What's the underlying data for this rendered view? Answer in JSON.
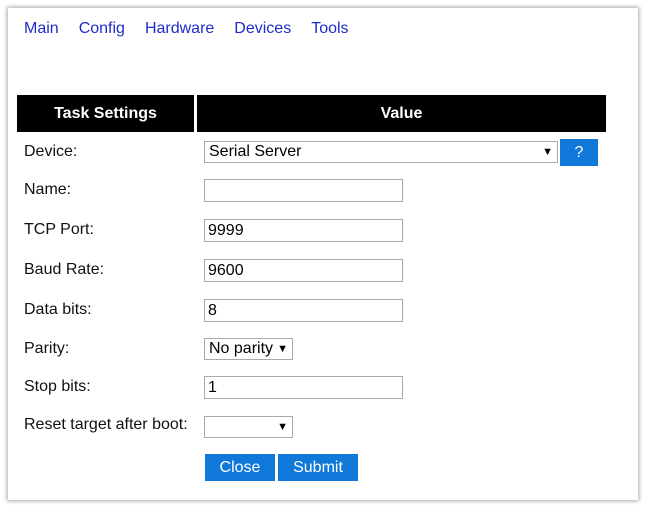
{
  "nav": {
    "items": [
      "Main",
      "Config",
      "Hardware",
      "Devices",
      "Tools"
    ]
  },
  "table": {
    "col_task": "Task Settings",
    "col_value": "Value"
  },
  "rows": {
    "device": {
      "label": "Device:",
      "value": "Serial Server",
      "help": "?"
    },
    "name": {
      "label": "Name:",
      "value": ""
    },
    "tcp_port": {
      "label": "TCP Port:",
      "value": "9999"
    },
    "baud_rate": {
      "label": "Baud Rate:",
      "value": "9600"
    },
    "data_bits": {
      "label": "Data bits:",
      "value": "8"
    },
    "parity": {
      "label": "Parity:",
      "value": "No parity"
    },
    "stop_bits": {
      "label": "Stop bits:",
      "value": "1"
    },
    "reset_target": {
      "label": "Reset target after boot:",
      "value": ""
    }
  },
  "buttons": {
    "close": "Close",
    "submit": "Submit"
  },
  "icons": {
    "dropdown": "triangle-down-icon"
  },
  "colors": {
    "nav_link": "#1f2cc8",
    "header_bg": "#000000",
    "button_bg": "#0f78d9"
  }
}
